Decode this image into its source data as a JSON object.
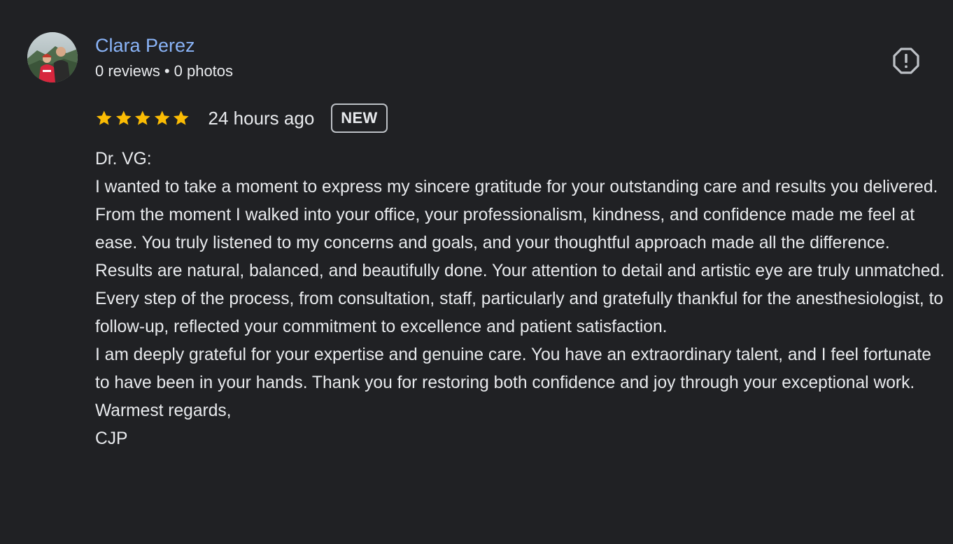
{
  "author": {
    "name": "Clara Perez",
    "reviews": "0 reviews",
    "separator": "•",
    "photos": "0 photos"
  },
  "rating": {
    "stars": 5,
    "max_stars": 5,
    "star_color": "#fbbc04",
    "time": "24 hours ago",
    "badge": "NEW"
  },
  "report_icon": "report-flag-icon",
  "review_paragraphs": [
    "Dr. VG:",
    "I wanted to take a moment to express my sincere gratitude for your outstanding care and results you delivered. From the moment I walked into your office, your professionalism, kindness, and confidence made me feel at ease. You truly listened to my concerns and goals, and your thoughtful approach made all the difference.",
    "Results are natural, balanced, and beautifully done. Your attention to detail and artistic eye are truly unmatched. Every step of the process, from consultation, staff, particularly and gratefully thankful for the anesthesiologist, to follow-up, reflected your commitment to excellence and patient satisfaction.",
    "I am deeply grateful for your expertise and genuine care. You have an extraordinary talent, and I feel fortunate to have been in your hands. Thank you for restoring both confidence and joy through your exceptional work.",
    "Warmest regards,",
    "CJP"
  ],
  "colors": {
    "background": "#202124",
    "text": "#e8eaed",
    "link": "#8ab4f8"
  }
}
